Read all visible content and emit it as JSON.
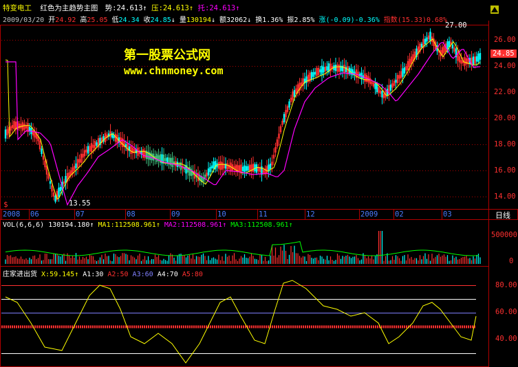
{
  "header": {
    "stock_name": "特变电工",
    "formula_name": "红色为主趋势主图",
    "shi_label": "势:",
    "shi_value": "24.613",
    "ya_label": "压:",
    "ya_value": "24.613",
    "tuo_label": "托:",
    "tuo_value": "24.613",
    "up_arrow": "↑",
    "down_arrow": "↓",
    "date": "2009/03/20",
    "open_label": "开",
    "open": "24.92",
    "high_label": "高",
    "high": "25.05",
    "low_label": "低",
    "low": "24.34",
    "close_label": "收",
    "close": "24.85",
    "vol_label": "量",
    "vol": "130194",
    "amount_label": "额",
    "amount": "32062",
    "turnover_label": "换",
    "turnover": "1.36%",
    "amplitude_label": "振",
    "amplitude": "2.85%",
    "change_label": "涨",
    "change": "(-0.09)-0.36%",
    "index_label": "指数",
    "index": "(15.33)0.68%"
  },
  "watermark": {
    "title": "第一股票公式网",
    "url": "www.chnmoney.com"
  },
  "price_axis": {
    "ticks": [
      "26.00",
      "24.00",
      "22.00",
      "20.00",
      "18.00",
      "16.00",
      "14.00"
    ],
    "current": "24.85",
    "max_label": "27.00",
    "min_label": "13.55",
    "period_button": "日线"
  },
  "months": [
    "2008",
    "06",
    "07",
    "08",
    "09",
    "10",
    "11",
    "12",
    "2009",
    "02",
    "03"
  ],
  "volume_panel": {
    "title": "VOL(6,6,6)",
    "value": "130194.180",
    "ma1_label": "MA1:",
    "ma1": "112508.961",
    "ma2_label": "MA2:",
    "ma2": "112508.961",
    "ma3_label": "MA3:",
    "ma3": "112508.961",
    "ticks": [
      "500000",
      "0"
    ]
  },
  "indicator_panel": {
    "title": "庄家进出货",
    "x_label": "X:",
    "x": "59.145",
    "a1_label": "A1:",
    "a1": "30",
    "a2_label": "A2:",
    "a2": "50",
    "a3_label": "A3:",
    "a3": "60",
    "a4_label": "A4:",
    "a4": "70",
    "a5_label": "A5:",
    "a5": "80",
    "ticks": [
      "80.00",
      "60.00",
      "40.00"
    ]
  },
  "colors": {
    "up": "#ff3030",
    "down": "#00ffff",
    "ma_yellow": "#ffff00",
    "ma_magenta": "#ff00ff",
    "grid": "#b00000"
  },
  "icons": {
    "scroll": "up-arrow-icon",
    "marker": "dollar-icon"
  }
}
